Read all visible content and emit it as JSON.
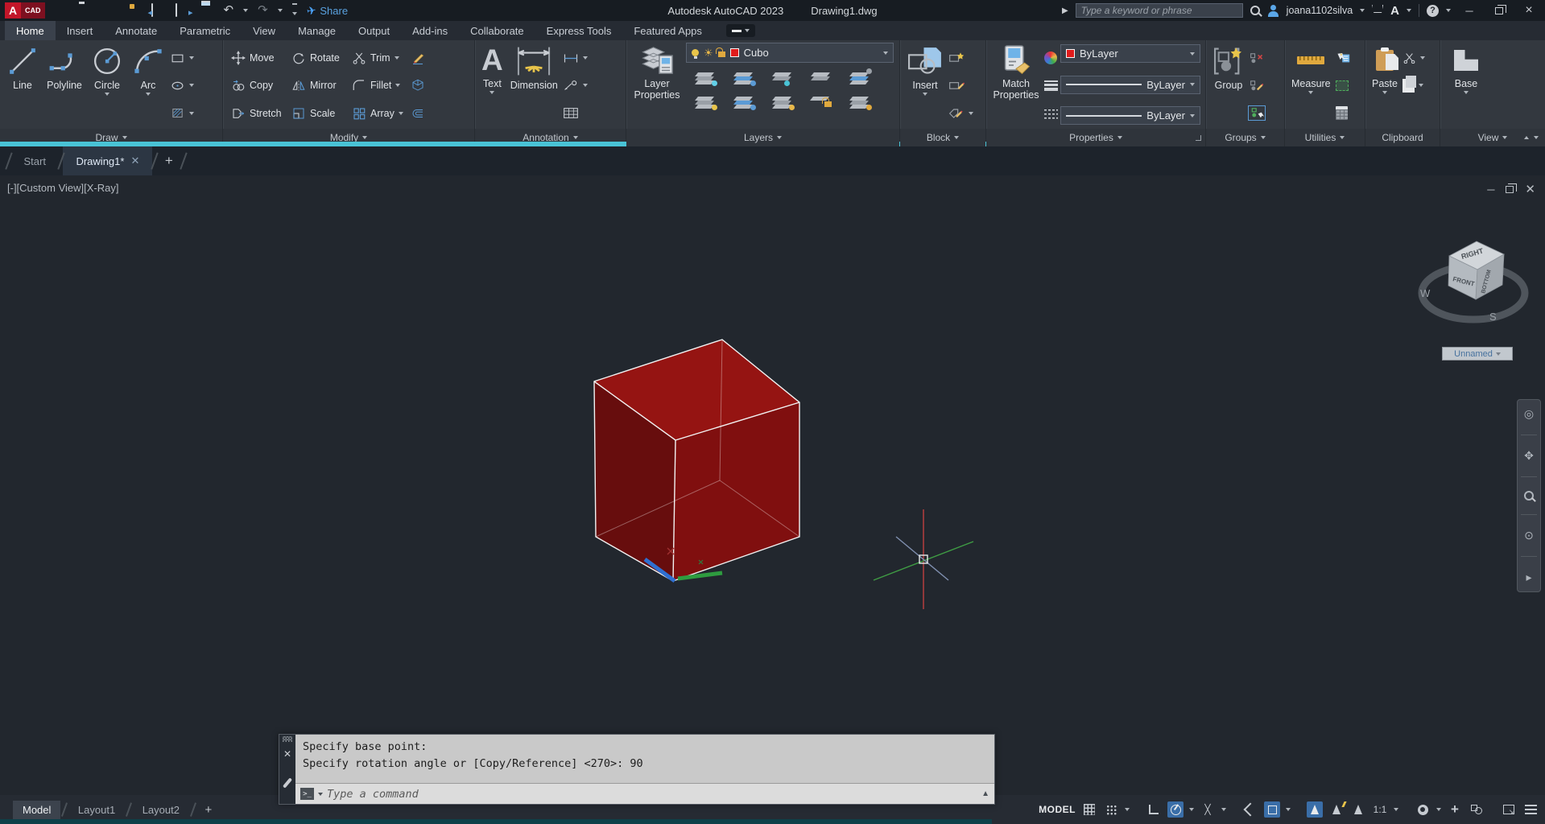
{
  "titlebar": {
    "logo_letter": "A",
    "logo_text": "CAD",
    "share": "Share",
    "app_title": "Autodesk AutoCAD 2023",
    "doc_title": "Drawing1.dwg",
    "search_placeholder": "Type a keyword or phrase",
    "username": "joana1102silva"
  },
  "ribbon_tabs": [
    "Home",
    "Insert",
    "Annotate",
    "Parametric",
    "View",
    "Manage",
    "Output",
    "Add-ins",
    "Collaborate",
    "Express Tools",
    "Featured Apps"
  ],
  "panel_labels": [
    "Draw",
    "Modify",
    "Annotation",
    "Layers",
    "Block",
    "Properties",
    "Groups",
    "Utilities",
    "Clipboard",
    "View"
  ],
  "draw": {
    "line": "Line",
    "polyline": "Polyline",
    "circle": "Circle",
    "arc": "Arc"
  },
  "modify": {
    "move": "Move",
    "copy": "Copy",
    "stretch": "Stretch",
    "rotate": "Rotate",
    "mirror": "Mirror",
    "scale": "Scale",
    "trim": "Trim",
    "fillet": "Fillet",
    "array": "Array"
  },
  "annotation": {
    "text": "Text",
    "dimension": "Dimension"
  },
  "layers": {
    "layer_properties": "Layer Properties",
    "current_layer": "Cubo"
  },
  "block": {
    "insert": "Insert"
  },
  "properties": {
    "match": "Match Properties",
    "color": "ByLayer",
    "lineweight": "ByLayer",
    "linetype": "ByLayer"
  },
  "groups": {
    "group": "Group"
  },
  "utilities": {
    "measure": "Measure"
  },
  "clipboard": {
    "paste": "Paste"
  },
  "view_panel": {
    "base": "Base"
  },
  "file_tabs": {
    "start": "Start",
    "active": "Drawing1*",
    "new_tab": "+"
  },
  "viewport": {
    "controls": "[-][Custom View][X-Ray]"
  },
  "viewcube": {
    "top": "RIGHT",
    "left": "FRONT",
    "right": "BOTTOM",
    "w": "W",
    "s": "S",
    "view_name": "Unnamed"
  },
  "command": {
    "line1": "Specify base point:",
    "line2": "Specify rotation angle or [Copy/Reference] <270>: 90",
    "placeholder": "Type a command"
  },
  "status": {
    "model_space": "MODEL",
    "annotation_scale": "1:1",
    "model_tab": "Model",
    "layout1": "Layout1",
    "layout2": "Layout2"
  },
  "colors": {
    "layer_red": "#e01b1b",
    "cube_top": "#9a1412",
    "cube_left": "#6a0c0c",
    "cube_right": "#840f0f",
    "highlight_blue": "#3a6ea8",
    "accent_blue": "#5b9bd5",
    "gold": "#e0a93e",
    "teal_strip": "#0e4049"
  }
}
